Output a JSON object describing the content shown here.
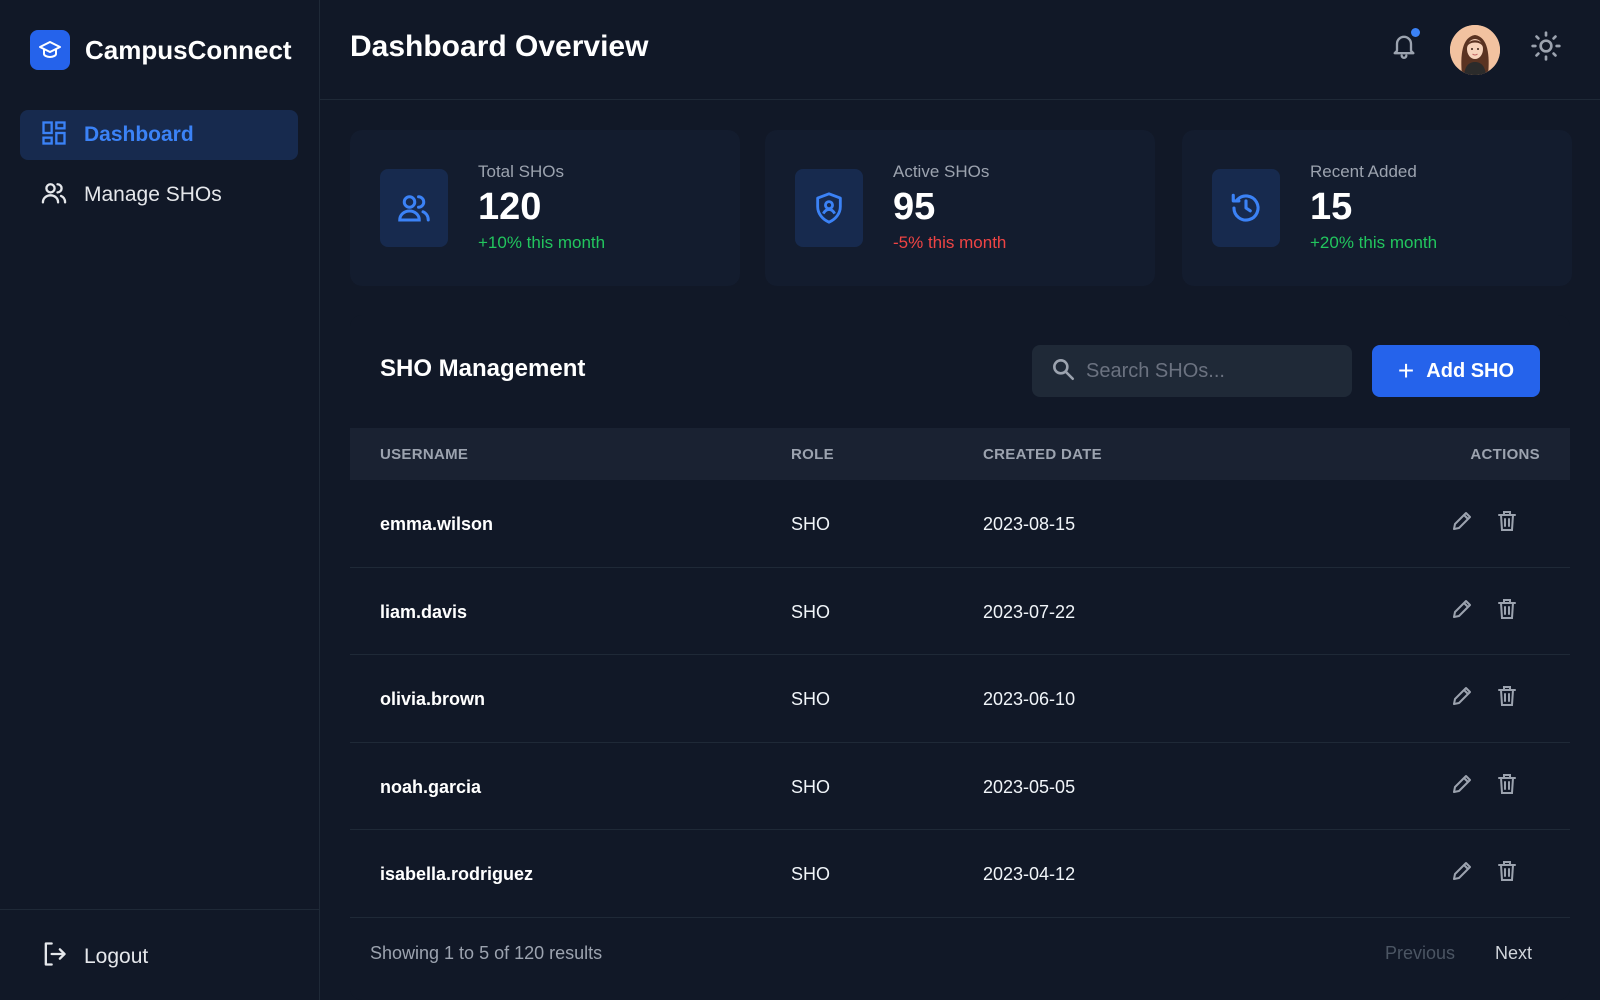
{
  "brand": {
    "name": "CampusConnect",
    "icon": "graduation-cap-icon",
    "accent": "#2563eb"
  },
  "sidebar": {
    "items": [
      {
        "label": "Dashboard",
        "icon": "dashboard-icon",
        "active": true
      },
      {
        "label": "Manage SHOs",
        "icon": "users-icon",
        "active": false
      }
    ],
    "logout_label": "Logout"
  },
  "header": {
    "title": "Dashboard Overview",
    "notification_icon": "bell-icon",
    "theme_icon": "sun-icon"
  },
  "stats": [
    {
      "label": "Total SHOs",
      "value": "120",
      "change": "+10% this month",
      "trend": "up",
      "icon": "users-icon"
    },
    {
      "label": "Active SHOs",
      "value": "95",
      "change": "-5% this month",
      "trend": "down",
      "icon": "shield-icon"
    },
    {
      "label": "Recent Added",
      "value": "15",
      "change": "+20% this month",
      "trend": "up",
      "icon": "history-icon"
    }
  ],
  "management": {
    "title": "SHO Management",
    "search_placeholder": "Search SHOs...",
    "add_label": "Add SHO",
    "columns": {
      "username": "USERNAME",
      "role": "ROLE",
      "created": "CREATED DATE",
      "actions": "ACTIONS"
    },
    "rows": [
      {
        "username": "emma.wilson",
        "role": "SHO",
        "created": "2023-08-15"
      },
      {
        "username": "liam.davis",
        "role": "SHO",
        "created": "2023-07-22"
      },
      {
        "username": "olivia.brown",
        "role": "SHO",
        "created": "2023-06-10"
      },
      {
        "username": "noah.garcia",
        "role": "SHO",
        "created": "2023-05-05"
      },
      {
        "username": "isabella.rodriguez",
        "role": "SHO",
        "created": "2023-04-12"
      }
    ],
    "footer": "Showing 1 to 5 of 120 results",
    "previous_label": "Previous",
    "next_label": "Next"
  },
  "colors": {
    "positive": "#22c55e",
    "negative": "#ef4444",
    "accent": "#3b82f6"
  }
}
